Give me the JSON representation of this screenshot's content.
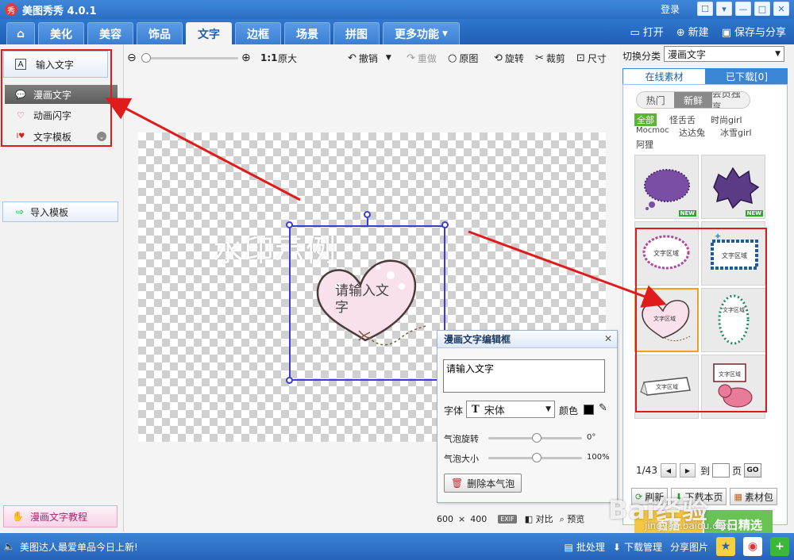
{
  "app": {
    "logo": "秀",
    "title": "美图秀秀 4.0.1",
    "login": "登录"
  },
  "tabs": [
    {
      "label": "美化"
    },
    {
      "label": "美容"
    },
    {
      "label": "饰品"
    },
    {
      "label": "文字"
    },
    {
      "label": "边框"
    },
    {
      "label": "场景"
    },
    {
      "label": "拼图"
    },
    {
      "label": "更多功能"
    }
  ],
  "top_actions": {
    "open": "打开",
    "new": "新建",
    "save_share": "保存与分享"
  },
  "left": {
    "input_text": "输入文字",
    "menu": [
      {
        "label": "漫画文字"
      },
      {
        "label": "动画闪字"
      },
      {
        "label": "文字模板"
      }
    ],
    "import_template": "导入模板",
    "tutorial": "漫画文字教程"
  },
  "toolbar": {
    "ratio": "1:1",
    "original_size": "原大",
    "undo": "撤销",
    "redo": "重做",
    "original": "原图",
    "rotate": "旋转",
    "crop": "裁剪",
    "size": "尺寸"
  },
  "canvas": {
    "watermark": "水印示例",
    "bubble_text": "请输入文字"
  },
  "editor": {
    "title": "漫画文字编辑框",
    "text": "请输入文字",
    "font_label": "字体",
    "font_value": "宋体",
    "color_label": "颜色",
    "color_value": "#000000",
    "rotation_label": "气泡旋转",
    "rotation_value": "0°",
    "rotation_fraction": 0.52,
    "size_label": "气泡大小",
    "size_value": "100%",
    "size_fraction": 0.52,
    "delete_label": "删除本气泡"
  },
  "canvas_status": {
    "width": "600",
    "height": "400",
    "times": "×",
    "exif": "EXIF",
    "compare": "对比",
    "preview": "预览"
  },
  "right": {
    "switch_label": "切换分类",
    "category": "漫画文字",
    "tabs": [
      {
        "label": "在线素材"
      },
      {
        "label": "已下载[0]"
      }
    ],
    "filters": [
      {
        "label": "热门"
      },
      {
        "label": "新鲜"
      },
      {
        "label": "会员独享"
      }
    ],
    "authors": [
      "全部",
      "怪舌舌",
      "时尚girl",
      "Mocmoc",
      "达达兔",
      "冰雪girl",
      "阿狸"
    ],
    "new_badge": "NEW",
    "thumb_text": "文字区域",
    "page": "1/43",
    "goto_label": "到",
    "page_unit": "页",
    "go": "GO",
    "actions": {
      "refresh": "刷新",
      "download_page": "下载本页",
      "material_pack": "素材包"
    },
    "promos": [
      "百搭",
      "每日精选"
    ]
  },
  "status": {
    "news": "美图达人最爱单品今日上新!",
    "batch": "批处理",
    "download_mgr": "下载管理",
    "share_img": "分享图片"
  },
  "watermark_site": {
    "logo": "Bai经验",
    "url": "jingyan.baidu.com"
  },
  "colors": {
    "accent": "#2b6fc5",
    "highlight": "#e01b1b",
    "selection": "#3b3bd6"
  }
}
